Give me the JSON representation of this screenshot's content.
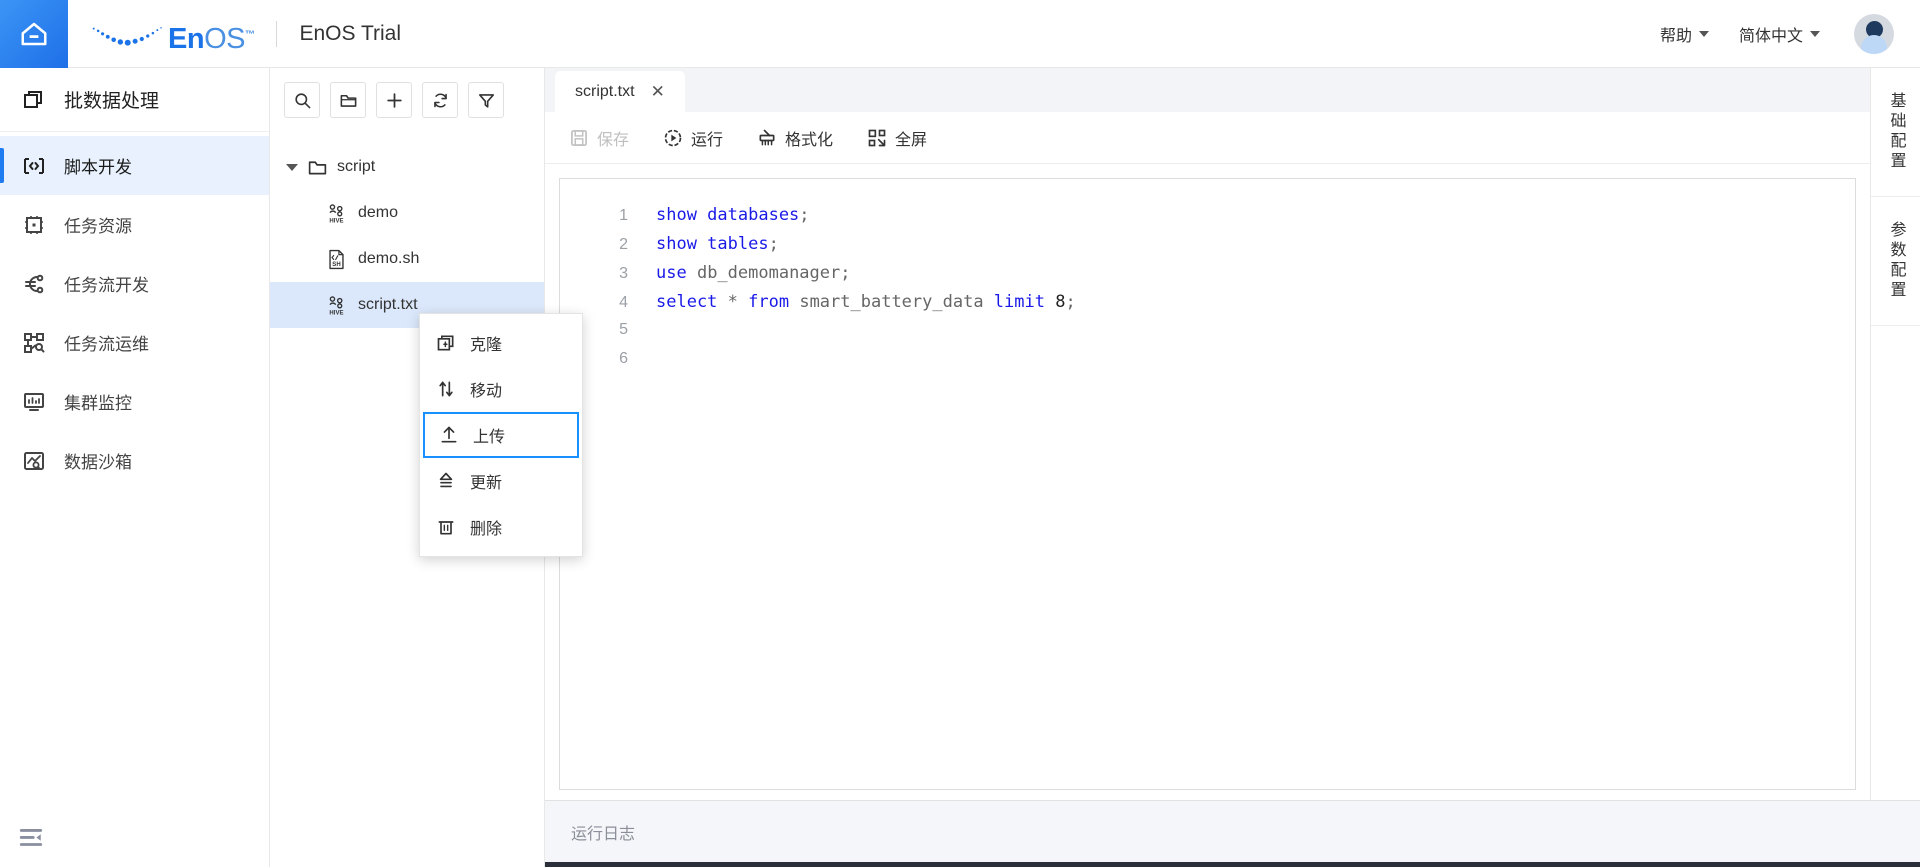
{
  "header": {
    "home_icon": "home-icon",
    "logo_en": "En",
    "logo_os": "OS",
    "logo_tm": "™",
    "title": "EnOS Trial",
    "help_label": "帮助",
    "language_label": "简体中文",
    "avatar_name": "user-avatar"
  },
  "sidebar": {
    "module_title": "批数据处理",
    "items": [
      {
        "label": "脚本开发",
        "icon": "script-code-icon",
        "active": true
      },
      {
        "label": "任务资源",
        "icon": "task-resource-icon",
        "active": false
      },
      {
        "label": "任务流开发",
        "icon": "workflow-dev-icon",
        "active": false
      },
      {
        "label": "任务流运维",
        "icon": "workflow-ops-icon",
        "active": false
      },
      {
        "label": "集群监控",
        "icon": "cluster-monitor-icon",
        "active": false
      },
      {
        "label": "数据沙箱",
        "icon": "data-sandbox-icon",
        "active": false
      }
    ],
    "collapse_icon": "collapse-sidebar-icon"
  },
  "tree_panel": {
    "toolbar": [
      {
        "icon": "search-icon",
        "name": "search-button"
      },
      {
        "icon": "new-folder-icon",
        "name": "new-folder-button"
      },
      {
        "icon": "plus-icon",
        "name": "add-button"
      },
      {
        "icon": "refresh-icon",
        "name": "refresh-button"
      },
      {
        "icon": "filter-icon",
        "name": "filter-button"
      }
    ],
    "nodes": [
      {
        "label": "script",
        "type": "folder",
        "expanded": true,
        "selected": false
      },
      {
        "label": "demo",
        "type": "hive",
        "selected": false
      },
      {
        "label": "demo.sh",
        "type": "shell",
        "selected": false
      },
      {
        "label": "script.txt",
        "type": "hive",
        "selected": true
      }
    ]
  },
  "context_menu": {
    "items": [
      {
        "label": "克隆",
        "icon": "clone-icon",
        "focused": false
      },
      {
        "label": "移动",
        "icon": "move-icon",
        "focused": false
      },
      {
        "label": "上传",
        "icon": "upload-icon",
        "focused": true
      },
      {
        "label": "更新",
        "icon": "update-icon",
        "focused": false
      },
      {
        "label": "删除",
        "icon": "delete-icon",
        "focused": false
      }
    ],
    "focus_color": "#1890ff"
  },
  "editor": {
    "tab_label": "script.txt",
    "tab_close": "✕",
    "toolbar": [
      {
        "label": "保存",
        "icon": "save-icon",
        "disabled": true
      },
      {
        "label": "运行",
        "icon": "run-icon",
        "disabled": false
      },
      {
        "label": "格式化",
        "icon": "format-icon",
        "disabled": false
      },
      {
        "label": "全屏",
        "icon": "fullscreen-icon",
        "disabled": false
      }
    ],
    "lines": [
      {
        "no": "1",
        "tokens": [
          {
            "t": "show databases",
            "c": "kw"
          },
          {
            "t": ";",
            "c": "punct"
          }
        ]
      },
      {
        "no": "2",
        "tokens": [
          {
            "t": "show tables",
            "c": "kw"
          },
          {
            "t": ";",
            "c": "punct"
          }
        ]
      },
      {
        "no": "3",
        "tokens": [
          {
            "t": "use",
            "c": "kw"
          },
          {
            "t": " db_demomanager;",
            "c": "id"
          }
        ]
      },
      {
        "no": "4",
        "tokens": [
          {
            "t": "select",
            "c": "kw"
          },
          {
            "t": " * ",
            "c": "id"
          },
          {
            "t": "from",
            "c": "kw"
          },
          {
            "t": " smart_battery_data ",
            "c": "id"
          },
          {
            "t": "limit",
            "c": "kw"
          },
          {
            "t": " ",
            "c": "id"
          },
          {
            "t": "8",
            "c": "num"
          },
          {
            "t": ";",
            "c": "punct"
          }
        ]
      },
      {
        "no": "5",
        "tokens": []
      },
      {
        "no": "6",
        "tokens": []
      }
    ]
  },
  "right_tabs": [
    {
      "label": "基础配置"
    },
    {
      "label": "参数配置"
    }
  ],
  "log_panel": {
    "title": "运行日志"
  },
  "colors": {
    "accent": "#1f7bf0",
    "focus_outline": "#1890ff",
    "active_nav_bg": "#e8f1fd",
    "selected_row_bg": "#dbe8fb",
    "keyword": "#1a1ae8",
    "identifier": "#666666",
    "disabled_text": "#bfbfbf",
    "log_bg": "#f5f6f9"
  }
}
